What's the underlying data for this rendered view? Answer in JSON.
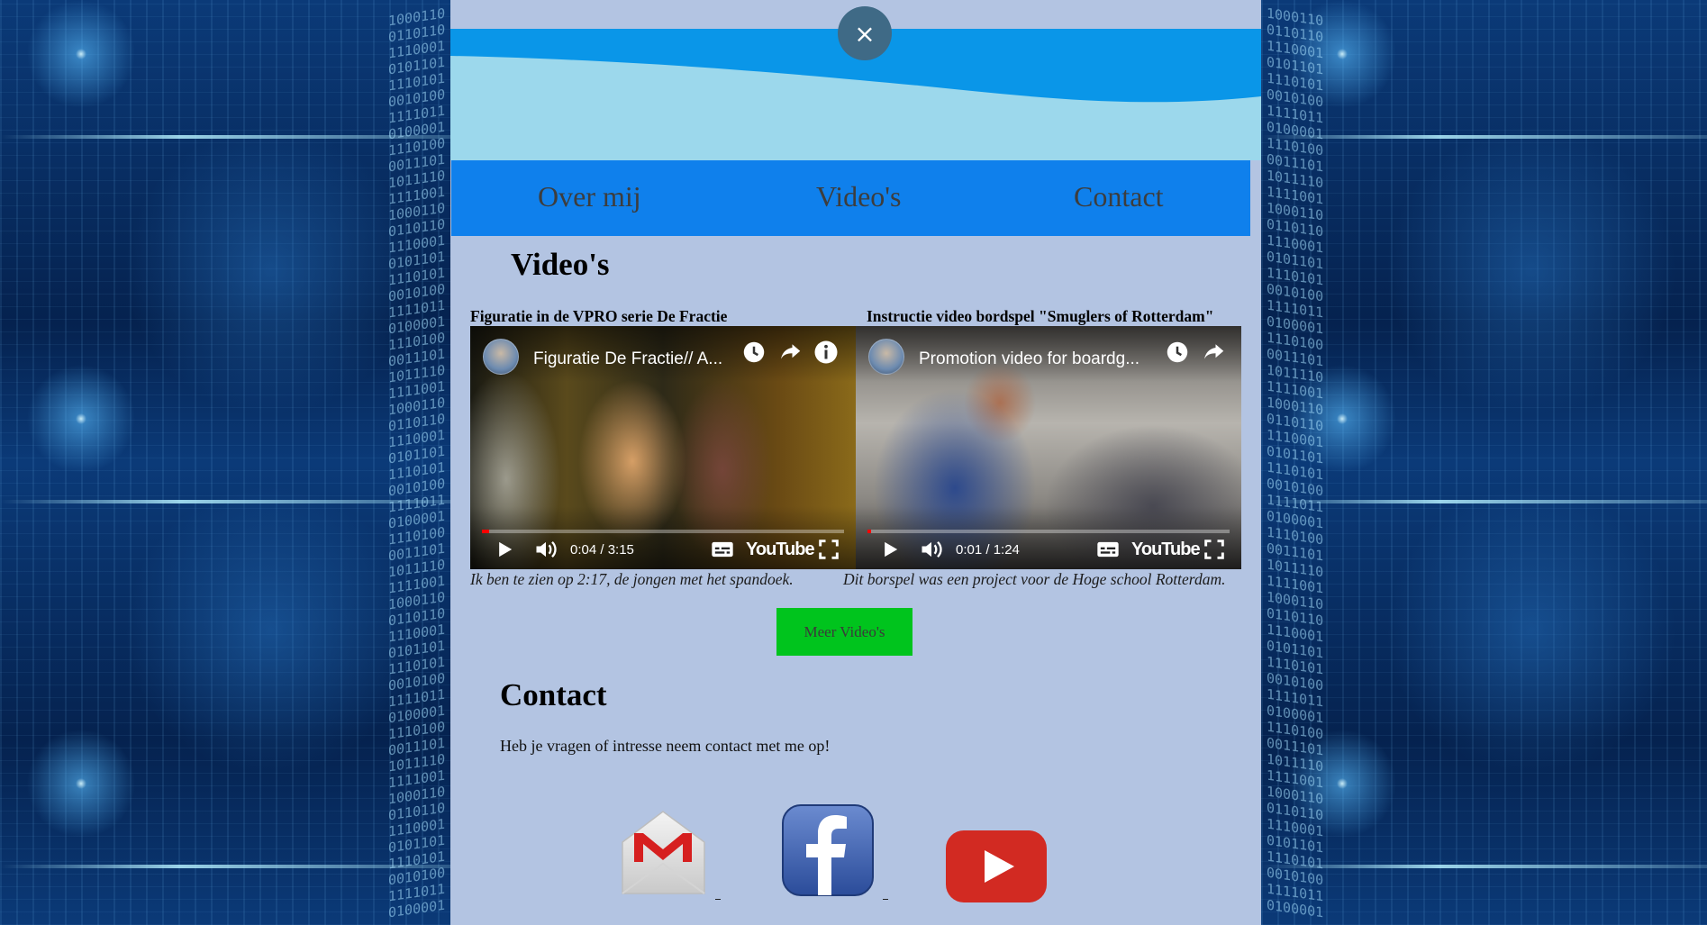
{
  "page": {
    "close_symbol": "×"
  },
  "nav": {
    "items": [
      {
        "label": "Over mij"
      },
      {
        "label": "Video's"
      },
      {
        "label": "Contact"
      }
    ]
  },
  "videos": {
    "heading": "Video's",
    "items": [
      {
        "title": "Figuratie in de VPRO serie De Fractie",
        "player_title": "Figuratie De Fractie// A...",
        "time": "0:04 / 3:15",
        "progress": 0.02,
        "caption": "Ik ben te zien op 2:17, de jongen met het spandoek."
      },
      {
        "title": "Instructie video bordspel \"Smuglers of Rotterdam\"",
        "player_title": "Promotion video for boardg...",
        "time": "0:01 / 1:24",
        "progress": 0.01,
        "caption": "Dit borspel was een project voor de Hoge school Rotterdam."
      }
    ],
    "youtube_word": "YouTube",
    "more_button": "Meer Video's"
  },
  "contact": {
    "heading": "Contact",
    "text": "Heb je vragen of intresse neem contact met me op!",
    "social_icons": [
      "gmail-icon",
      "facebook-icon",
      "youtube-icon"
    ]
  },
  "colors": {
    "page_bg": "#b3c4e2",
    "nav_bg": "#0f80ec",
    "wave_dark": "#0a96e8",
    "wave_light": "#9cd8ec",
    "button_green": "#00c41d",
    "close_button": "#3f6a86"
  }
}
